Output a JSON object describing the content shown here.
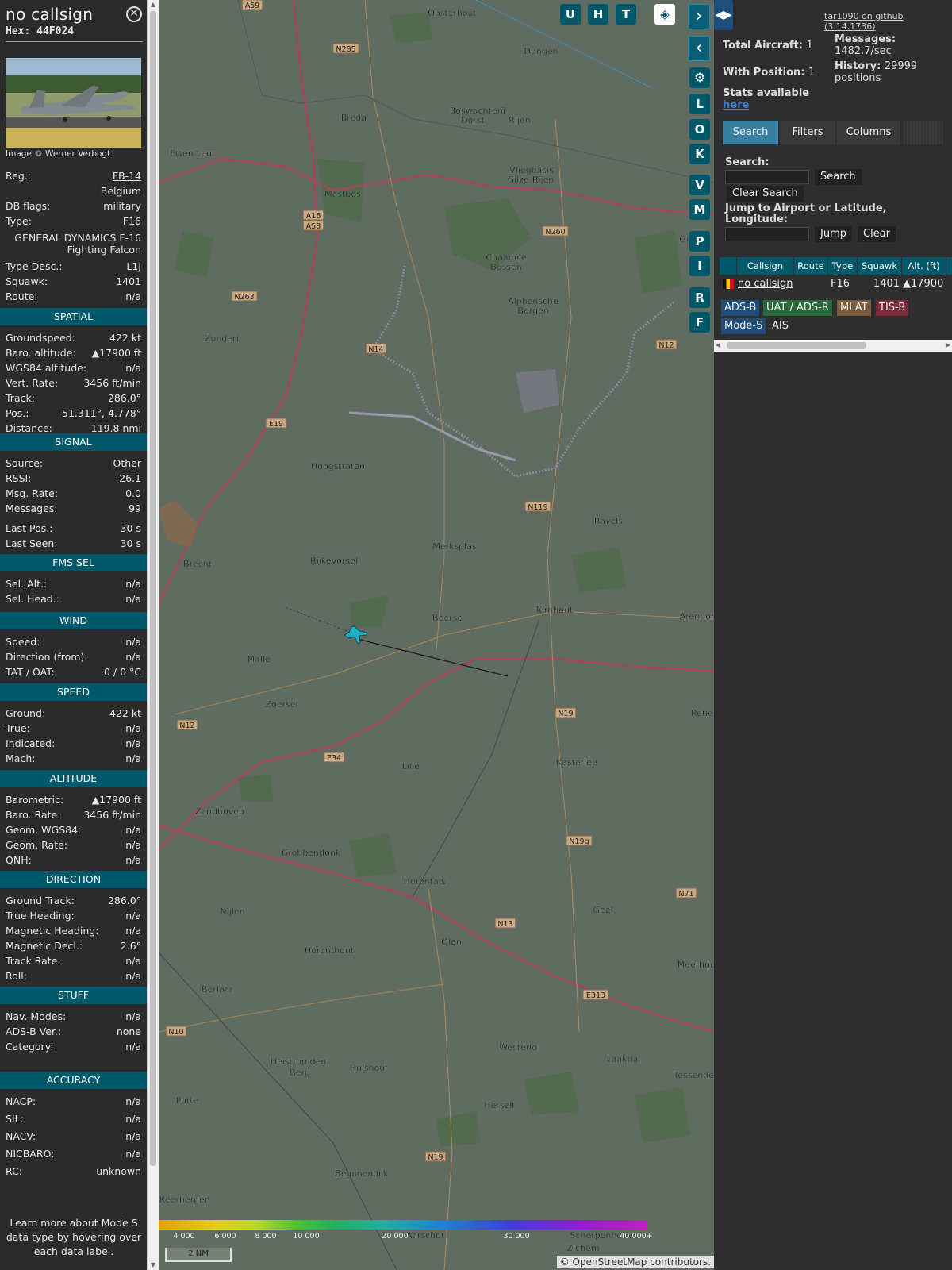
{
  "aircraft": {
    "callsign": "no callsign",
    "hex": "Hex: 44F024",
    "photo_credit": "Image © Werner Verbogt",
    "reg_label": "Reg.:",
    "reg": "FB-14",
    "country": "Belgium",
    "dbflags_label": "DB flags:",
    "dbflags": "military",
    "type_label": "Type:",
    "type": "F16",
    "type_full": "GENERAL DYNAMICS F-16 Fighting Falcon",
    "typedesc_label": "Type Desc.:",
    "typedesc": "L1J",
    "squawk_label": "Squawk:",
    "squawk": "1401",
    "route_label": "Route:",
    "route": "n/a"
  },
  "sections": {
    "spatial": {
      "title": "SPATIAL",
      "rows": [
        [
          "Groundspeed:",
          "422 kt"
        ],
        [
          "Baro. altitude:",
          "▲17900 ft"
        ],
        [
          "WGS84 altitude:",
          "n/a"
        ],
        [
          "Vert. Rate:",
          "3456 ft/min"
        ],
        [
          "Track:",
          "286.0°"
        ],
        [
          "Pos.:",
          "51.311°, 4.778°"
        ],
        [
          "Distance:",
          "119.8 nmi"
        ]
      ]
    },
    "signal": {
      "title": "SIGNAL",
      "rows": [
        [
          "Source:",
          "Other"
        ],
        [
          "RSSI:",
          "-26.1"
        ],
        [
          "Msg. Rate:",
          "0.0"
        ],
        [
          "Messages:",
          "99"
        ],
        [
          "Last Pos.:",
          "30 s"
        ],
        [
          "Last Seen:",
          "30 s"
        ]
      ]
    },
    "fms": {
      "title": "FMS SEL",
      "rows": [
        [
          "Sel. Alt.:",
          "n/a"
        ],
        [
          "Sel. Head.:",
          "n/a"
        ]
      ]
    },
    "wind": {
      "title": "WIND",
      "rows": [
        [
          "Speed:",
          "n/a"
        ],
        [
          "Direction (from):",
          "n/a"
        ],
        [
          "TAT / OAT:",
          "0 / 0 °C"
        ]
      ]
    },
    "speed": {
      "title": "SPEED",
      "rows": [
        [
          "Ground:",
          "422 kt"
        ],
        [
          "True:",
          "n/a"
        ],
        [
          "Indicated:",
          "n/a"
        ],
        [
          "Mach:",
          "n/a"
        ]
      ]
    },
    "altitude": {
      "title": "ALTITUDE",
      "rows": [
        [
          "Barometric:",
          "▲17900 ft"
        ],
        [
          "Baro. Rate:",
          "3456 ft/min"
        ],
        [
          "Geom. WGS84:",
          "n/a"
        ],
        [
          "Geom. Rate:",
          "n/a"
        ],
        [
          "QNH:",
          "n/a"
        ]
      ]
    },
    "direction": {
      "title": "DIRECTION",
      "rows": [
        [
          "Ground Track:",
          "286.0°"
        ],
        [
          "True Heading:",
          "n/a"
        ],
        [
          "Magnetic Heading:",
          "n/a"
        ],
        [
          "Magnetic Decl.:",
          "2.6°"
        ],
        [
          "Track Rate:",
          "n/a"
        ],
        [
          "Roll:",
          "n/a"
        ]
      ]
    },
    "stuff": {
      "title": "STUFF",
      "rows": [
        [
          "Nav. Modes:",
          "n/a"
        ],
        [
          "ADS-B Ver.:",
          "none"
        ],
        [
          "Category:",
          "n/a"
        ]
      ]
    },
    "accuracy": {
      "title": "ACCURACY",
      "rows": [
        [
          "NACP:",
          "n/a"
        ],
        [
          "SIL:",
          "n/a"
        ],
        [
          "NACV:",
          "n/a"
        ],
        [
          "NICBARO:",
          "n/a"
        ],
        [
          "RC:",
          "unknown"
        ]
      ]
    }
  },
  "learn_more": "Learn more about Mode S data type by hovering over each data label.",
  "map": {
    "top_buttons": [
      "U",
      "H",
      "T"
    ],
    "side_buttons": [
      "L",
      "O",
      "K",
      "V",
      "M",
      "P",
      "I",
      "R",
      "F"
    ],
    "places": [
      [
        "Oosterhout",
        570,
        20
      ],
      [
        "Dongen",
        682,
        68
      ],
      [
        "Breda",
        446,
        152
      ],
      [
        "Rijen",
        655,
        155
      ],
      [
        "Etten-Leur",
        243,
        197
      ],
      [
        "Vliegbasis",
        670,
        218
      ],
      [
        "Gilze-Rijen",
        669,
        230
      ],
      [
        "Mastbos",
        432,
        248
      ],
      [
        "Chaamse",
        638,
        328
      ],
      [
        "Bossen",
        638,
        340
      ],
      [
        "Alphensche",
        672,
        383
      ],
      [
        "Bergen",
        672,
        395
      ],
      [
        "Zundert",
        280,
        430
      ],
      [
        "Hoogstraten",
        426,
        591
      ],
      [
        "Ravels",
        767,
        660
      ],
      [
        "Merksplas",
        573,
        692
      ],
      [
        "Rijkevorsel",
        421,
        710
      ],
      [
        "Brecht",
        249,
        714
      ],
      [
        "Beerse",
        564,
        782
      ],
      [
        "Turnhout",
        698,
        772
      ],
      [
        "Malle",
        326,
        834
      ],
      [
        "Zoersel",
        355,
        891
      ],
      [
        "Kasterlee",
        727,
        964
      ],
      [
        "Lille",
        518,
        969
      ],
      [
        "Zandhoven",
        277,
        1026
      ],
      [
        "Grobbendonk",
        392,
        1078
      ],
      [
        "Herentals",
        535,
        1114
      ],
      [
        "Nijlen",
        293,
        1152
      ],
      [
        "Geel",
        760,
        1150
      ],
      [
        "Olen",
        569,
        1190
      ],
      [
        "Herenthout",
        415,
        1201
      ],
      [
        "Berlaar",
        274,
        1250
      ],
      [
        "Westerlo",
        653,
        1323
      ],
      [
        "Laakdal",
        786,
        1338
      ],
      [
        "Heist-op-den-",
        378,
        1341
      ],
      [
        "Berg",
        378,
        1355
      ],
      [
        "Hulshout",
        465,
        1349
      ],
      [
        "Putte",
        236,
        1390
      ],
      [
        "Herselt",
        630,
        1396
      ],
      [
        "Begijnendijk",
        456,
        1482
      ],
      [
        "Keerbergen",
        233,
        1515
      ],
      [
        "Aarschot",
        536,
        1560
      ],
      [
        "Scherpenheuvel-",
        765,
        1560
      ],
      [
        "Zichem",
        735,
        1576
      ],
      [
        "Gilze",
        870,
        305
      ],
      [
        "Arendonk",
        883,
        780
      ],
      [
        "Retie",
        885,
        902
      ],
      [
        "Meerhout",
        880,
        1219
      ],
      [
        "Tessenderlo",
        882,
        1358
      ],
      [
        "Boswachterij",
        602,
        143
      ],
      [
        "Dorst",
        596,
        155
      ]
    ],
    "road_labels": [
      [
        "A59",
        318,
        8
      ],
      [
        "N285",
        436,
        63
      ],
      [
        "N263",
        308,
        375
      ],
      [
        "N260",
        700,
        293
      ],
      [
        "N14",
        474,
        441
      ],
      [
        "N12",
        840,
        436
      ],
      [
        "E19",
        348,
        535
      ],
      [
        "N119",
        678,
        640
      ],
      [
        "N19",
        713,
        900
      ],
      [
        "N12",
        236,
        915
      ],
      [
        "E34",
        421,
        956
      ],
      [
        "N19g",
        730,
        1061
      ],
      [
        "N71",
        865,
        1127
      ],
      [
        "N13",
        637,
        1165
      ],
      [
        "E313",
        751,
        1255
      ],
      [
        "N10",
        222,
        1301
      ],
      [
        "N19",
        549,
        1459
      ],
      [
        "A16",
        395,
        273
      ],
      [
        "A58",
        395,
        286
      ]
    ],
    "scale_label": "2 NM",
    "alt_ticks": [
      "4 000",
      "6 000",
      "8 000",
      "10 000",
      "20 000",
      "30 000",
      "40 000+"
    ],
    "attribution": "© OpenStreetMap contributors.",
    "zoom_in": "+",
    "zoom_out": "−"
  },
  "panel": {
    "github": "tar1090 on github (3.14.1736)",
    "total_label": "Total Aircraft:",
    "total": "1",
    "withpos_label": "With Position:",
    "withpos": "1",
    "messages_label": "Messages:",
    "messages": "1482.7/sec",
    "history_label": "History:",
    "history": "29999 positions",
    "stats_label": "Stats available",
    "stats_link": "here",
    "tabs": [
      "Search",
      "Filters",
      "Columns"
    ],
    "search_label": "Search:",
    "search_btn": "Search",
    "clear_search_btn": "Clear Search",
    "jump_label": "Jump to Airport or Latitude, Longitude:",
    "jump_btn": "Jump",
    "clear_btn": "Clear",
    "table_headers": [
      "Callsign",
      "Route",
      "Type",
      "Squawk",
      "Alt. (ft)"
    ],
    "row": {
      "callsign": "no callsign",
      "route": "",
      "type": "F16",
      "squawk": "1401",
      "alt": "▲17900"
    },
    "sources": [
      [
        "ADS-B",
        "#1f4e7a"
      ],
      [
        "UAT / ADS-R",
        "#2a6a3a"
      ],
      [
        "MLAT",
        "#7a5a3a"
      ],
      [
        "TIS-B",
        "#7a2a3a"
      ],
      [
        "Mode-S",
        "#1f4e7a"
      ],
      [
        "AIS",
        "#2e2e2e"
      ]
    ]
  }
}
